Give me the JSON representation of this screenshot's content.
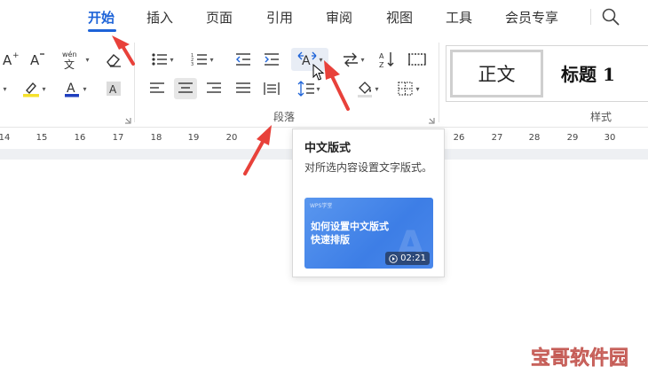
{
  "menu": {
    "tabs": [
      {
        "label": "开始",
        "active": true
      },
      {
        "label": "插入"
      },
      {
        "label": "页面"
      },
      {
        "label": "引用"
      },
      {
        "label": "审阅"
      },
      {
        "label": "视图"
      },
      {
        "label": "工具"
      },
      {
        "label": "会员专享"
      }
    ],
    "search_icon": "search-icon"
  },
  "ribbon": {
    "font_group": {
      "icons": [
        "increase-font-size-icon",
        "decrease-font-size-icon",
        "phonetic-guide-icon",
        "clear-format-icon",
        "highlight-icon",
        "font-color-icon",
        "character-shading-icon"
      ],
      "phonetic_label": "wén"
    },
    "paragraph_group": {
      "label": "段落",
      "icons": [
        "bullets-icon",
        "numbering-icon",
        "decrease-indent-icon",
        "increase-indent-icon",
        "chinese-layout-icon",
        "text-direction-icon",
        "sort-icon",
        "show-marks-icon",
        "align-left-icon",
        "align-center-icon",
        "align-right-icon",
        "justify-icon",
        "distributed-icon",
        "line-spacing-icon",
        "shading-icon",
        "borders-icon"
      ]
    },
    "styles_group": {
      "label": "样式",
      "items": [
        "正文",
        "标题 1"
      ]
    },
    "colors": {
      "highlight": "#f5e12b",
      "font_color": "#1f3fbf",
      "accent": "#1d63d8"
    }
  },
  "ruler": {
    "numbers": [
      "14",
      "15",
      "16",
      "17",
      "18",
      "19",
      "20",
      "26",
      "27",
      "28",
      "29",
      "30"
    ]
  },
  "tooltip": {
    "title": "中文版式",
    "description": "对所选内容设置文字版式。",
    "video": {
      "brand": "WPS学堂",
      "title": "如何设置中文版式\n快速排版",
      "duration": "02:21"
    }
  },
  "watermark": {
    "text": "宝哥软件园"
  },
  "annotation_color": "#e8413a"
}
